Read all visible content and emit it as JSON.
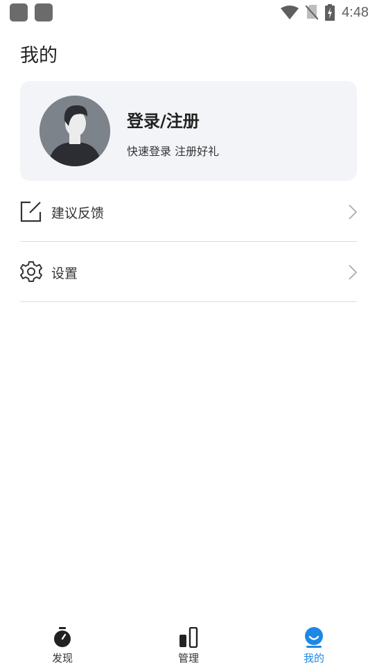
{
  "status_bar": {
    "time": "4:48",
    "icons": [
      "notification-square-icon",
      "notification-square-icon",
      "wifi-icon",
      "no-sim-icon",
      "battery-charging-icon"
    ]
  },
  "page": {
    "title": "我的"
  },
  "profile": {
    "name": "登录/注册",
    "subtitle": "快速登录 注册好礼",
    "avatar_icon": "user-avatar-icon"
  },
  "menu": [
    {
      "label": "建议反馈",
      "icon": "feedback-edit-icon"
    },
    {
      "label": "设置",
      "icon": "gear-icon"
    }
  ],
  "bottom_nav": {
    "active": "我的",
    "items": [
      {
        "label": "发现",
        "icon": "stopwatch-icon"
      },
      {
        "label": "管理",
        "icon": "bars-icon"
      },
      {
        "label": "我的",
        "icon": "profile-icon"
      }
    ]
  },
  "colors": {
    "accent": "#1e88e5",
    "card_bg": "#f3f4f8",
    "divider": "#dcdcdc",
    "text": "#222222"
  }
}
